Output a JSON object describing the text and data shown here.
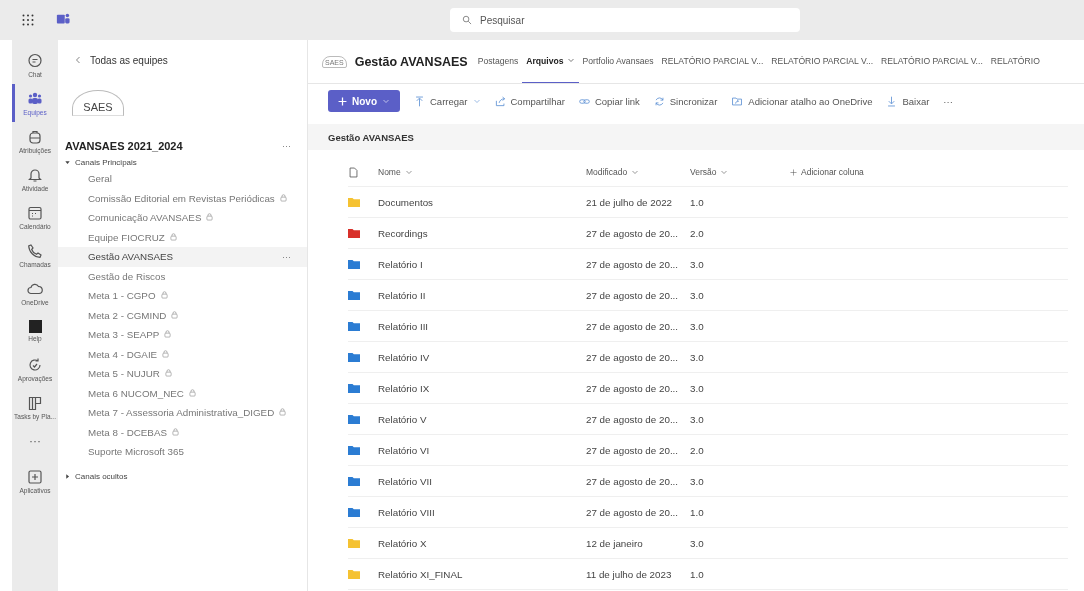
{
  "top_bar": {
    "search": {
      "placeholder": "Pesquisar"
    }
  },
  "rail": [
    {
      "label": "Chat",
      "kind": "chat",
      "selected": false
    },
    {
      "label": "Equipes",
      "kind": "teams",
      "selected": true
    },
    {
      "label": "Atribuições",
      "kind": "bag",
      "selected": false
    },
    {
      "label": "Atividade",
      "kind": "bell",
      "selected": false
    },
    {
      "label": "Calendário",
      "kind": "calendar",
      "selected": false
    },
    {
      "label": "Chamadas",
      "kind": "phone",
      "selected": false
    },
    {
      "label": "OneDrive",
      "kind": "cloud",
      "selected": false
    },
    {
      "label": "Help",
      "kind": "app",
      "selected": false
    },
    {
      "label": "Aprovações",
      "kind": "approve",
      "selected": false
    },
    {
      "label": "Tasks by Pla...",
      "kind": "tasks",
      "selected": false
    },
    {
      "label": "···",
      "kind": "more",
      "selected": false
    },
    {
      "label": "Aplicativos",
      "kind": "add",
      "selected": false
    }
  ],
  "channel_panel": {
    "back": "Todas as equipes",
    "logo": "SAES",
    "team": "AVANSAES 2021_2024",
    "team_more": "···",
    "item_more": "···",
    "sections": [
      {
        "label": "Canais Principais",
        "expanded": true,
        "channels": [
          {
            "name": "Geral",
            "locked": false,
            "selected": false
          },
          {
            "name": "Comissão Editorial em Revistas Periódicas",
            "locked": true,
            "selected": false
          },
          {
            "name": "Comunicação AVANSAES",
            "locked": true,
            "selected": false
          },
          {
            "name": "Equipe FIOCRUZ",
            "locked": true,
            "selected": false
          },
          {
            "name": "Gestão AVANSAES",
            "locked": false,
            "selected": true
          },
          {
            "name": "Gestão de Riscos",
            "locked": false,
            "selected": false
          },
          {
            "name": "Meta 1 - CGPO",
            "locked": true,
            "selected": false
          },
          {
            "name": "Meta 2 - CGMIND",
            "locked": true,
            "selected": false
          },
          {
            "name": "Meta 3 - SEAPP",
            "locked": true,
            "selected": false
          },
          {
            "name": "Meta 4 - DGAIE",
            "locked": true,
            "selected": false
          },
          {
            "name": "Meta 5 - NUJUR",
            "locked": true,
            "selected": false
          },
          {
            "name": "Meta 6 NUCOM_NEC",
            "locked": true,
            "selected": false
          },
          {
            "name": "Meta 7 - Assessoria Administrativa_DIGED",
            "locked": true,
            "selected": false
          },
          {
            "name": "Meta 8 - DCEBAS",
            "locked": true,
            "selected": false
          },
          {
            "name": "Suporte Microsoft 365",
            "locked": false,
            "selected": false
          }
        ]
      },
      {
        "label": "Canais ocultos",
        "expanded": false
      }
    ]
  },
  "channel_header": {
    "logo": "SAES",
    "title": "Gestão AVANSAES",
    "tabs": [
      {
        "label": "Postagens",
        "selected": false,
        "dropdown": false
      },
      {
        "label": "Arquivos",
        "selected": true,
        "dropdown": true
      },
      {
        "label": "Portfolio Avansaes",
        "selected": false,
        "dropdown": false
      },
      {
        "label": "RELATÓRIO PARCIAL V...",
        "selected": false,
        "dropdown": false
      },
      {
        "label": "RELATÓRIO PARCIAL V...",
        "selected": false,
        "dropdown": false
      },
      {
        "label": "RELATÓRIO PARCIAL V...",
        "selected": false,
        "dropdown": false
      },
      {
        "label": "RELATÓRIO",
        "selected": false,
        "dropdown": false
      }
    ]
  },
  "toolbar": {
    "new_button": "Novo",
    "actions": [
      {
        "label": "Carregar",
        "kind": "upload",
        "dropdown": true
      },
      {
        "label": "Compartilhar",
        "kind": "share",
        "dropdown": false
      },
      {
        "label": "Copiar link",
        "kind": "link",
        "dropdown": false
      },
      {
        "label": "Sincronizar",
        "kind": "sync",
        "dropdown": false
      },
      {
        "label": "Adicionar atalho ao OneDrive",
        "kind": "shortcut",
        "dropdown": false
      },
      {
        "label": "Baixar",
        "kind": "download",
        "dropdown": false
      },
      {
        "label": "···",
        "kind": "more",
        "dropdown": false
      }
    ]
  },
  "breadcrumb": "Gestão AVANSAES",
  "table": {
    "columns": [
      "Nome",
      "Modificado",
      "Versão"
    ],
    "add_column": "Adicionar coluna",
    "rows": [
      {
        "name": "Documentos",
        "color": "#f5c232",
        "modified": "21 de julho de 2022",
        "version": "1.0"
      },
      {
        "name": "Recordings",
        "color": "#d8302a",
        "modified": "27 de agosto de 20...",
        "version": "2.0"
      },
      {
        "name": "Relatório I",
        "color": "#2b7cd3",
        "modified": "27 de agosto de 20...",
        "version": "3.0"
      },
      {
        "name": "Relatório II",
        "color": "#2b7cd3",
        "modified": "27 de agosto de 20...",
        "version": "3.0"
      },
      {
        "name": "Relatório III",
        "color": "#2b7cd3",
        "modified": "27 de agosto de 20...",
        "version": "3.0"
      },
      {
        "name": "Relatório IV",
        "color": "#2b7cd3",
        "modified": "27 de agosto de 20...",
        "version": "3.0"
      },
      {
        "name": "Relatório IX",
        "color": "#2b7cd3",
        "modified": "27 de agosto de 20...",
        "version": "3.0"
      },
      {
        "name": "Relatório V",
        "color": "#2b7cd3",
        "modified": "27 de agosto de 20...",
        "version": "3.0"
      },
      {
        "name": "Relatório VI",
        "color": "#2b7cd3",
        "modified": "27 de agosto de 20...",
        "version": "2.0"
      },
      {
        "name": "Relatório VII",
        "color": "#2b7cd3",
        "modified": "27 de agosto de 20...",
        "version": "3.0"
      },
      {
        "name": "Relatório VIII",
        "color": "#2b7cd3",
        "modified": "27 de agosto de 20...",
        "version": "1.0"
      },
      {
        "name": "Relatório X",
        "color": "#f5c232",
        "modified": "12 de janeiro",
        "version": "3.0"
      },
      {
        "name": "Relatório XI_FINAL",
        "color": "#f5c232",
        "modified": "11 de julho de 2023",
        "version": "1.0"
      }
    ]
  }
}
